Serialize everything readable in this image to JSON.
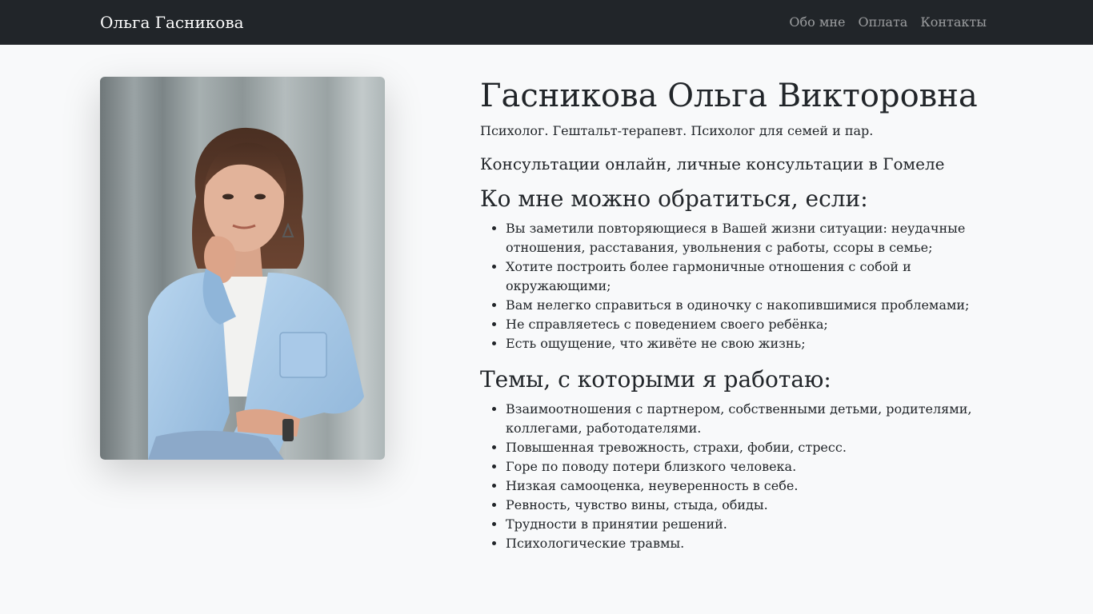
{
  "navbar": {
    "brand": "Ольга Гасникова",
    "links": [
      "Обо мне",
      "Оплата",
      "Контакты"
    ]
  },
  "profile": {
    "name": "Гасникова Ольга Викторовна",
    "subtitle": "Психолог. Гештальт-терапевт. Психолог для семей и пар.",
    "consultations": "Консультации онлайн, личные консультации в Гомеле"
  },
  "reasons": {
    "title": "Ко мне можно обратиться, если:",
    "items": [
      "Вы заметили повторяющиеся в Вашей жизни ситуации: неудачные отношения, расставания, увольнения с работы, ссоры в семье;",
      "Хотите построить более гармоничные отношения с собой и окружающими;",
      "Вам нелегко справиться в одиночку с накопившимися проблемами;",
      "Не справляетесь с поведением своего ребёнка;",
      "Есть ощущение, что живёте не свою жизнь;"
    ]
  },
  "topics": {
    "title": "Темы, с которыми я работаю:",
    "items": [
      "Взаимоотношения с партнером, собственными детьми, родителями, коллегами, работодателями.",
      "Повышенная тревожность, страхи, фобии, стресс.",
      "Горе по поводу потери близкого человека.",
      "Низкая самооценка, неуверенность в себе.",
      "Ревность, чувство вины, стыда, обиды.",
      "Трудности в принятии решений.",
      "Психологические травмы."
    ]
  },
  "colors": {
    "navbar_bg": "#212529",
    "page_bg": "#f8f9fa",
    "text": "#212529",
    "nav_link": "rgba(255,255,255,0.55)"
  }
}
